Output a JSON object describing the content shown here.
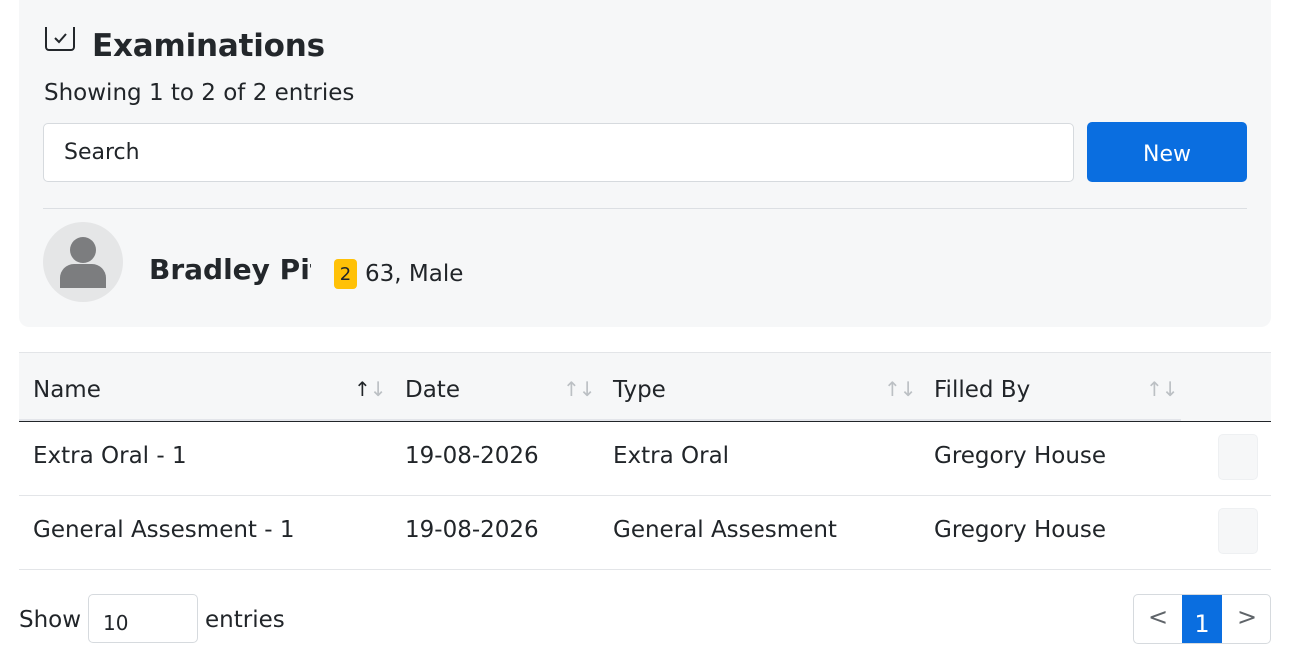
{
  "header": {
    "title": "Examinations",
    "subtitle": "Showing 1 to 2 of 2 entries",
    "icon": "checkbox-icon"
  },
  "search": {
    "placeholder": "Search",
    "value": ""
  },
  "new_button": {
    "label": "New"
  },
  "patient": {
    "name": "Bradley Pitt",
    "badge": "2",
    "meta": "63, Male",
    "avatar_icon": "person-icon"
  },
  "table": {
    "columns": [
      "Name",
      "Date",
      "Type",
      "Filled By"
    ],
    "sort_icon": "↑↓",
    "rows": [
      {
        "name": "Extra Oral - 1",
        "date": "19-08-2026",
        "type": "Extra Oral",
        "filled_by": "Gregory House"
      },
      {
        "name": "General Assesment - 1",
        "date": "19-08-2026",
        "type": "General Assesment",
        "filled_by": "Gregory House"
      }
    ]
  },
  "footer": {
    "show_label": "Show",
    "page_size": "10",
    "entries_label": "entries",
    "prev": "<",
    "current_page": "1",
    "next": ">"
  },
  "colors": {
    "primary": "#0a6ee0",
    "badge": "#ffc107",
    "card_bg": "#f6f7f8"
  }
}
